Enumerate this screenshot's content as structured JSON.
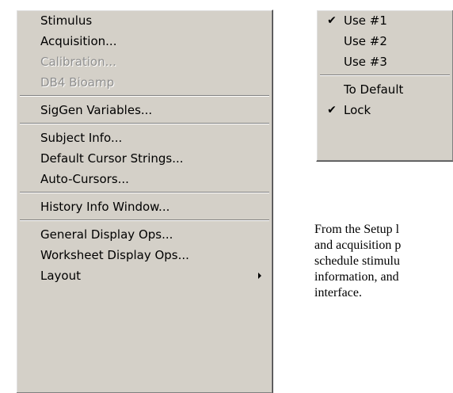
{
  "setup_menu": {
    "groups": [
      [
        "Stimulus",
        "Acquisition...",
        "Calibration...",
        "DB4 Bioamp"
      ],
      [
        "SigGen Variables..."
      ],
      [
        "Subject Info...",
        "Default Cursor Strings...",
        "Auto-Cursors..."
      ],
      [
        "History Info Window..."
      ],
      [
        "General Display Ops...",
        "Worksheet Display Ops...",
        "Layout"
      ]
    ],
    "disabled_items": [
      "Calibration...",
      "DB4 Bioamp"
    ],
    "submenu_items": [
      "Layout"
    ],
    "submenu_arrow_icon": "submenu-arrow-icon"
  },
  "use_menu": {
    "items": [
      "Use #1",
      "Use #2",
      "Use #3",
      "To Default",
      "Lock"
    ],
    "checked": [
      "Use #1",
      "Lock"
    ],
    "check_glyph": "✔",
    "check_icon": "checkmark-icon"
  },
  "caption": {
    "lines": [
      "From the Setup l",
      "and acquisition p",
      "schedule stimulu",
      "information, and",
      "interface."
    ]
  },
  "colors": {
    "menu_bg": "#d4d0c8",
    "disabled_text": "#8f8f8f",
    "separator_dark": "#808080"
  }
}
